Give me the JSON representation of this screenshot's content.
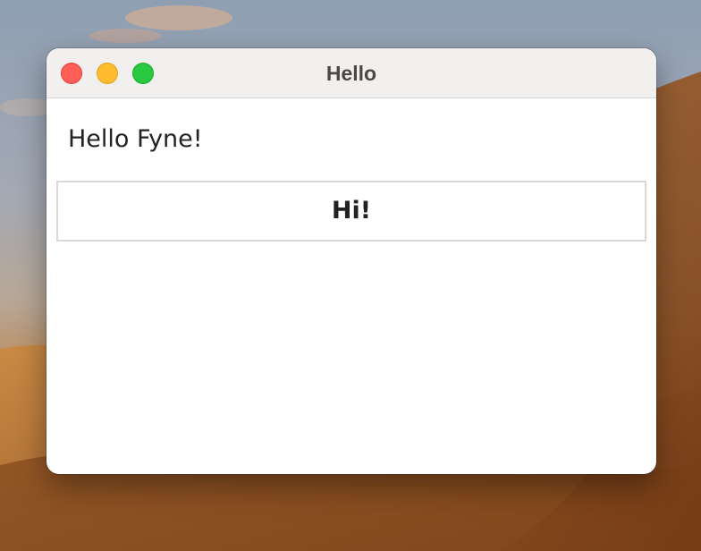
{
  "window": {
    "title": "Hello",
    "controls": {
      "close": "close-icon",
      "minimize": "minimize-icon",
      "zoom": "zoom-icon"
    }
  },
  "content": {
    "label": "Hello Fyne!",
    "button_label": "Hi!"
  },
  "colors": {
    "close": "#ff5f57",
    "minimize": "#febc2e",
    "zoom": "#28c840",
    "titlebar": "#f2f0ee",
    "window_background": "#ffffff"
  }
}
